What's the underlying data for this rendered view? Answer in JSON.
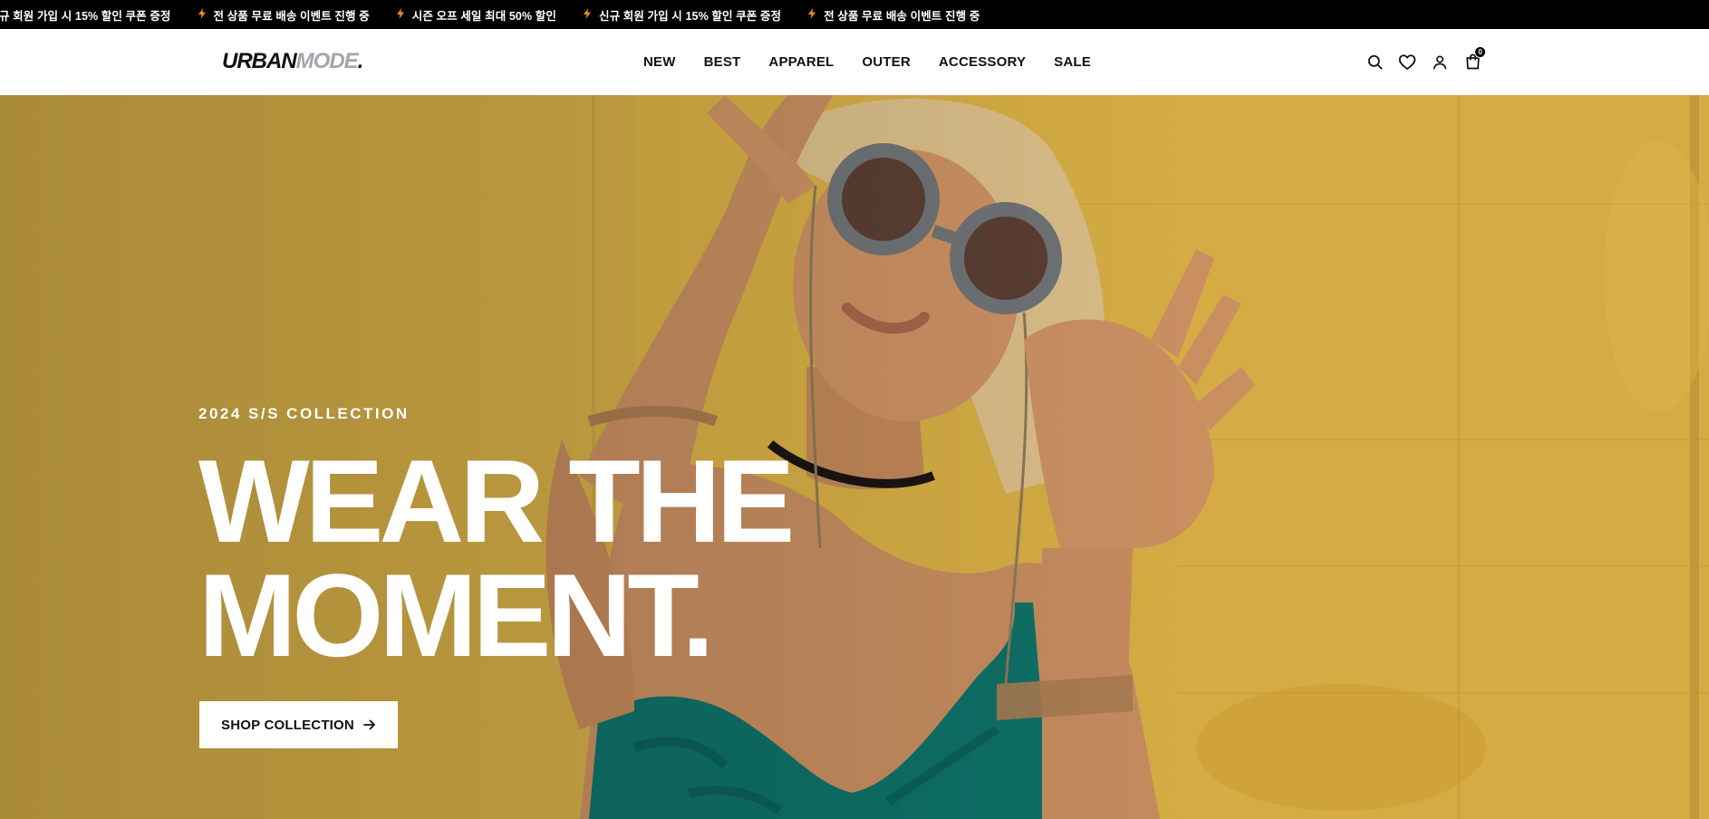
{
  "ticker": {
    "items": [
      "규 회원 가입 시 15% 할인 쿠폰 증정",
      "전 상품 무료 배송 이벤트 진행 중",
      "시즌 오프 세일 최대 50% 할인",
      "신규 회원 가입 시 15% 할인 쿠폰 증정",
      "전 상품 무료 배송 이벤트 진행 중"
    ],
    "bolt_color": "#f08a24"
  },
  "header": {
    "logo": {
      "part1": "URBAN",
      "part2": "MODE",
      "part3": "."
    },
    "nav": [
      "NEW",
      "BEST",
      "APPAREL",
      "OUTER",
      "ACCESSORY",
      "SALE"
    ],
    "icons": [
      "search-icon",
      "heart-icon",
      "user-icon",
      "shopping-bag-icon"
    ],
    "cart_count": "0"
  },
  "hero": {
    "eyebrow": "2024 S/S COLLECTION",
    "headline_line1": "WEAR THE",
    "headline_line2": "MOMENT.",
    "cta_label": "SHOP COLLECTION",
    "cta_icon": "arrow-right-icon",
    "background_color": "#d8b146"
  }
}
